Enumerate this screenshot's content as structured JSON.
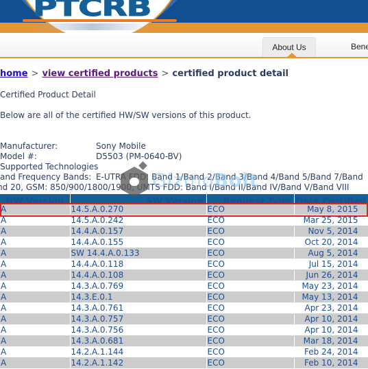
{
  "site": {
    "logo_text": "PTCRB",
    "brand_blue": "#124f91",
    "brand_orange": "#e89533"
  },
  "nav": {
    "tabs": [
      {
        "label": "About Us",
        "active": true
      },
      {
        "label": "Bene",
        "active": false
      }
    ]
  },
  "breadcrumb": {
    "home": "home",
    "separator": ">",
    "products": "view certified products",
    "current": "certified product detail"
  },
  "page": {
    "heading": "Certified Product Detail",
    "intro": "Below are all of the certified HW/SW versions of this product."
  },
  "details": {
    "manufacturer_label": "Manufacturer:",
    "manufacturer_value": "Sony Mobile",
    "model_label": "Model #:",
    "model_value": "D5503 (PM-0640-BV)",
    "tech_label_line1": "Supported Technologies",
    "tech_label_line2": "and Frequency Bands:",
    "bands_line1": "E-UTRA FDD: Band 1/Band 2/Band 3/Band 4/Band 5/Band 7/Band",
    "bands_line2": "nd 20, GSM: 850/900/1800/1900, UMTS FDD: Band I/Band II/Band IV/Band V/Band VIII"
  },
  "table": {
    "columns": [
      "HW Version",
      "SW Version",
      "Request Type",
      "Date Certified"
    ],
    "highlight_color": "#e11f26",
    "rows": [
      {
        "hw": "A",
        "sw": "14.5.A.0.270",
        "req": "ECO",
        "date": "May 8, 2015"
      },
      {
        "hw": "A",
        "sw": "14.5.A.0.242",
        "req": "ECO",
        "date": "Mar 25, 2015"
      },
      {
        "hw": "A",
        "sw": "14.4.A.0.157",
        "req": "ECO",
        "date": "Nov 5, 2014"
      },
      {
        "hw": "A",
        "sw": "14.4.A.0.155",
        "req": "ECO",
        "date": "Oct 20, 2014"
      },
      {
        "hw": "A",
        "sw": "SW 14.4.A.0.133",
        "req": "ECO",
        "date": "Aug 5, 2014"
      },
      {
        "hw": "A",
        "sw": "14.4.A.0.118",
        "req": "ECO",
        "date": "Jul 15, 2014"
      },
      {
        "hw": "A",
        "sw": "14.4.A.0.108",
        "req": "ECO",
        "date": "Jun 26, 2014"
      },
      {
        "hw": "A",
        "sw": "14.3.A.0.769",
        "req": "ECO",
        "date": "May 23, 2014"
      },
      {
        "hw": "A",
        "sw": "14.3.E.0.1",
        "req": "ECO",
        "date": "May 13, 2014"
      },
      {
        "hw": "A",
        "sw": "14.3.A.0.761",
        "req": "ECO",
        "date": "Apr 23, 2014"
      },
      {
        "hw": "A",
        "sw": "14.3.A.0.757",
        "req": "ECO",
        "date": "Apr 10, 2014"
      },
      {
        "hw": "A",
        "sw": "14.3.A.0.756",
        "req": "ECO",
        "date": "Apr 10, 2014"
      },
      {
        "hw": "A",
        "sw": "14.3.A.0.681",
        "req": "ECO",
        "date": "Mar 18, 2014"
      },
      {
        "hw": "A",
        "sw": "14.2.A.1.144",
        "req": "ECO",
        "date": "Feb 24, 2014"
      },
      {
        "hw": "A",
        "sw": "14.2.A.1.142",
        "req": "ECO",
        "date": "Feb 10, 2014"
      }
    ]
  },
  "watermark": {
    "text_light": "Gizmo",
    "text_bold": "Bolt"
  }
}
